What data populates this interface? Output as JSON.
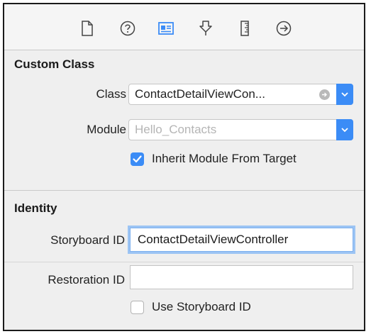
{
  "toolbar": {
    "icons": [
      "file-inspector-icon",
      "quick-help-icon",
      "identity-inspector-icon",
      "attributes-inspector-icon",
      "size-inspector-icon",
      "connections-inspector-icon"
    ],
    "accent": "#3b8cf6"
  },
  "custom_class": {
    "header": "Custom Class",
    "class_label": "Class",
    "class_value": "ContactDetailViewCon...",
    "module_label": "Module",
    "module_placeholder": "Hello_Contacts",
    "inherit_label": "Inherit Module From Target",
    "inherit_checked": true
  },
  "identity": {
    "header": "Identity",
    "storyboard_id_label": "Storyboard ID",
    "storyboard_id_value": "ContactDetailViewController",
    "restoration_id_label": "Restoration ID",
    "restoration_id_value": "",
    "use_storyboard_label": "Use Storyboard ID",
    "use_storyboard_checked": false
  }
}
